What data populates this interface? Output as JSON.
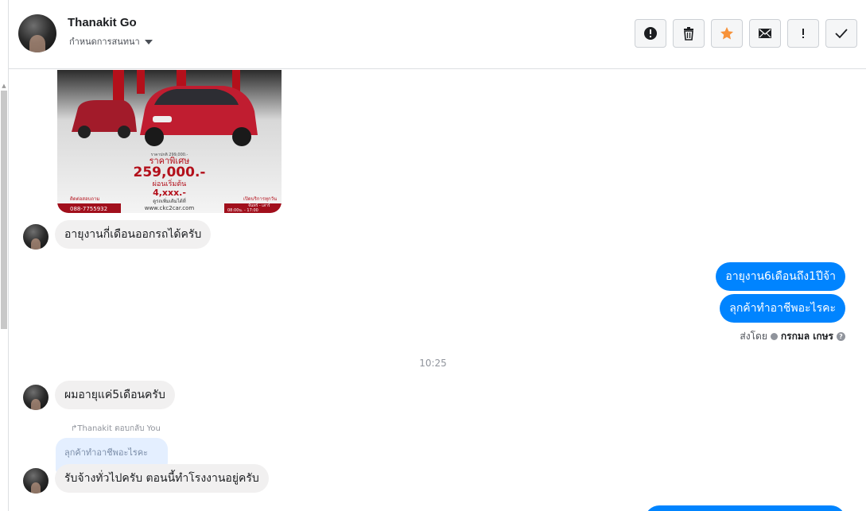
{
  "header": {
    "contact_name": "Thanakit Go",
    "conversation_settings": "กำหนดการสนทนา",
    "actions": [
      {
        "name": "mark-spam-button",
        "icon": "alert-circle-icon"
      },
      {
        "name": "delete-button",
        "icon": "trash-icon"
      },
      {
        "name": "star-button",
        "icon": "star-icon",
        "color": "#f7923a"
      },
      {
        "name": "mark-unread-button",
        "icon": "envelope-icon"
      },
      {
        "name": "follow-up-button",
        "icon": "exclamation-icon"
      },
      {
        "name": "mark-done-button",
        "icon": "check-icon"
      }
    ]
  },
  "image_ad": {
    "price_label": "ราคาพิเศษ",
    "price": "259,000.-",
    "installment_label": "ผ่อนเริ่มต้น",
    "installment": "4,xxx.-",
    "old_price": "ราคาปกติ 299,000.-",
    "phone": "088-7755932",
    "contact_label": "ติดต่อสอบถาม",
    "website": "www.ckc2car.com",
    "more_info": "ดูรถเพิ่มเติมได้ที่",
    "open_label": "เปิดบริการทุกวัน",
    "days": "จันทร์ - เสาร์",
    "hours": "08:00น. - 17:00"
  },
  "messages": {
    "in_1": "อายุงานกี่เดือนออกรถได้ครับ",
    "out_1": "อายุงาน6เดือนถึง1ปีจ้า",
    "out_2": "ลุกค้าทำอาชีพอะไรคะ",
    "sent_by_label": "ส่งโดย",
    "sent_by_name": "กรกมล เกษร",
    "help_glyph": "?",
    "timestamp": "10:25",
    "in_2": "ผมอายุแค่5เดือนครับ",
    "reply_hint": "Thanakit ตอบกลับ You",
    "quoted": "ลุกค้าทำอาชีพอะไรคะ",
    "in_3": "รับจ้างทั่วไปครับ ตอนนี้ทำโรงงานอยู่ครับ"
  },
  "colors": {
    "outgoing_bubble": "#0084ff",
    "incoming_bubble": "#f1f0f0",
    "quoted_bubble": "#e4efff",
    "star": "#f7923a"
  }
}
